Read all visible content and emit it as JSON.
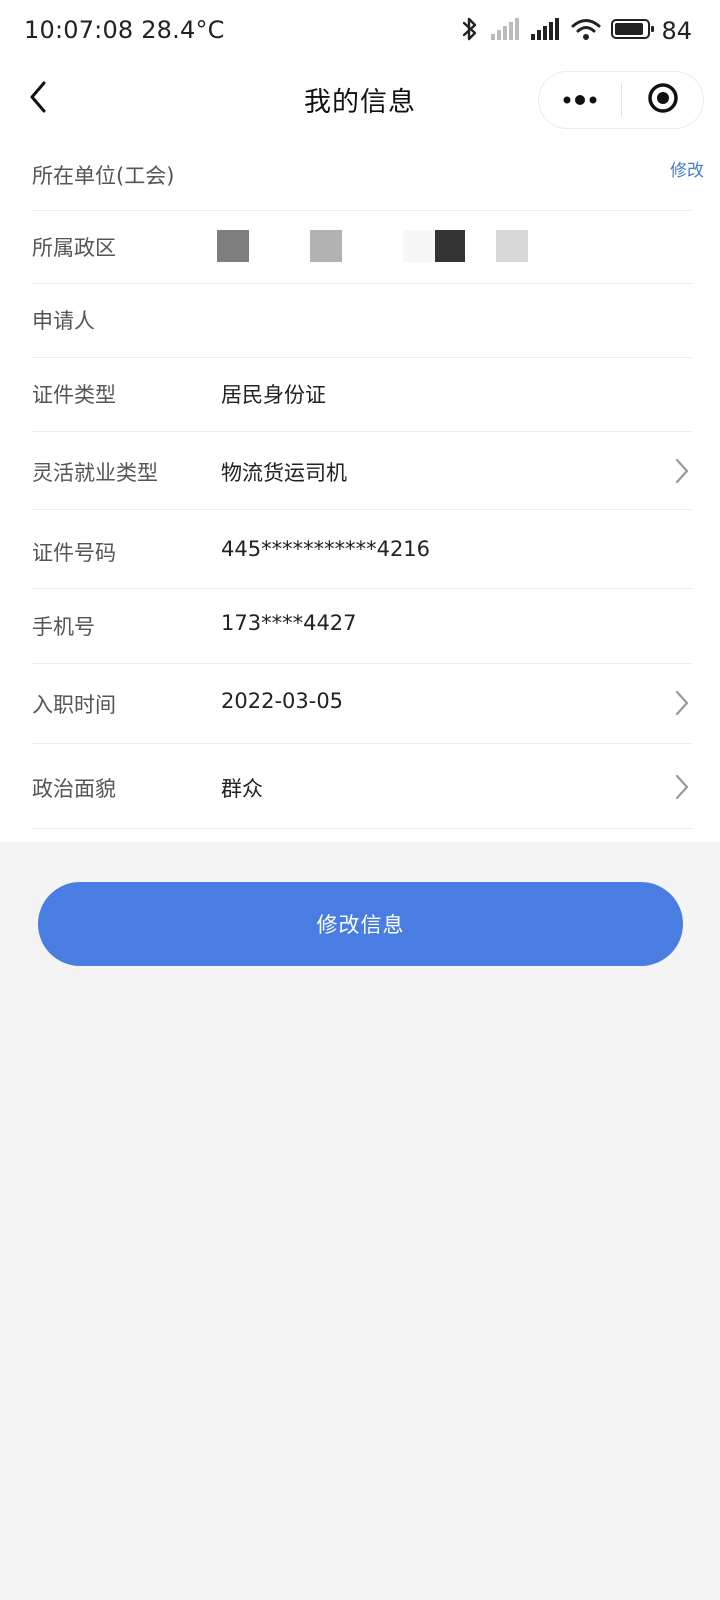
{
  "status_bar": {
    "time_temp": "10:07:08 28.4°C",
    "battery": "84"
  },
  "nav": {
    "title": "我的信息"
  },
  "form": {
    "rows": [
      {
        "label": "所在单位(工会)",
        "value": ""
      },
      {
        "label": "所属政区",
        "value": ""
      },
      {
        "label": "申请人",
        "value": ""
      },
      {
        "label": "证件类型",
        "value": "居民身份证"
      },
      {
        "label": "灵活就业类型",
        "value": "物流货运司机"
      },
      {
        "label": "证件号码",
        "value": "445***********4216"
      },
      {
        "label": "手机号",
        "value": "173****4427"
      },
      {
        "label": "入职时间",
        "value": "2022-03-05"
      },
      {
        "label": "政治面貌",
        "value": "群众"
      }
    ],
    "edit_link": "修改"
  },
  "actions": {
    "modify_button": "修改信息"
  },
  "icons": {
    "back": "back-chevron-icon",
    "more": "more-dots-icon",
    "close": "capsule-close-icon",
    "arrow": "chevron-right-icon",
    "bluetooth": "bluetooth-icon",
    "signal": "signal-icon",
    "wifi": "wifi-icon",
    "battery": "battery-icon"
  },
  "colors": {
    "primary": "#4a7de2",
    "link": "#4a7cc9",
    "background": "#f4f4f4"
  }
}
